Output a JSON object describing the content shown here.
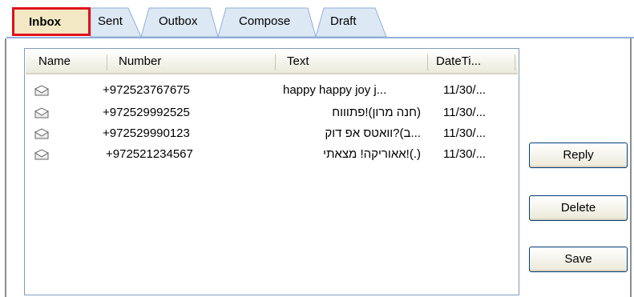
{
  "tabs": [
    {
      "label": "Inbox",
      "active": true
    },
    {
      "label": "Sent"
    },
    {
      "label": "Outbox"
    },
    {
      "label": "Compose"
    },
    {
      "label": "Draft"
    }
  ],
  "list": {
    "columns": [
      "Name",
      "Number",
      "Text",
      "DateTi..."
    ],
    "rows": [
      {
        "name": "",
        "number": "+972523767675",
        "text": "happy happy joy j...",
        "date": "11/30/..."
      },
      {
        "name": "",
        "number": "+972529992525",
        "text": "(חנה מרון)!פתוווח",
        "date": "11/30/..."
      },
      {
        "name": "",
        "number": "+972529990123",
        "text": "...ב)?וואטס אפ דוק",
        "date": "11/30/..."
      },
      {
        "name": "",
        "number": "+972521234567",
        "text": "(.)!אאוריקה! מצאתי",
        "date": "11/30/..."
      }
    ]
  },
  "buttons": {
    "reply": "Reply",
    "delete": "Delete",
    "save": "Save"
  },
  "colors": {
    "active_tab_border": "#e0121b",
    "active_tab_bg": "#f3e8c4",
    "tab_bg": "#dde8f5"
  },
  "icons": {
    "message_row": "envelope-icon"
  }
}
